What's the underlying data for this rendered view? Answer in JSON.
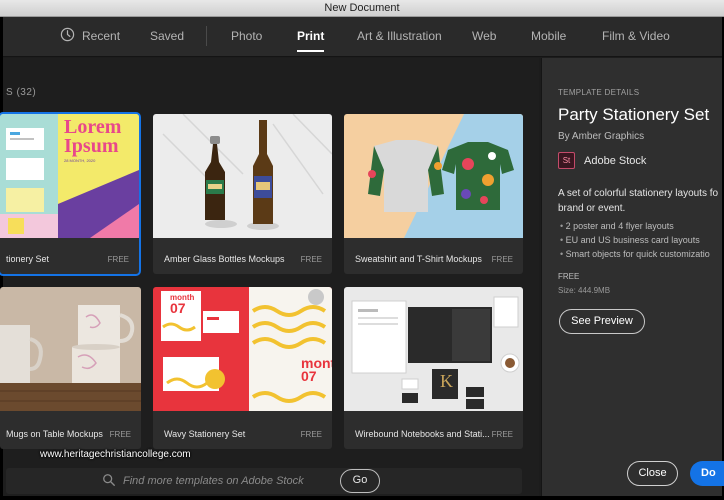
{
  "window": {
    "title": "New Document"
  },
  "tabs": [
    {
      "label": "Recent",
      "icon": "clock-icon"
    },
    {
      "label": "Saved"
    },
    {
      "label": "Photo"
    },
    {
      "label": "Print",
      "active": true
    },
    {
      "label": "Art & Illustration"
    },
    {
      "label": "Web"
    },
    {
      "label": "Mobile"
    },
    {
      "label": "Film & Video"
    }
  ],
  "section": {
    "title": "S  (32)"
  },
  "templates": [
    {
      "name": "tionery Set",
      "price": "FREE",
      "selected": true
    },
    {
      "name": "Amber Glass Bottles Mockups",
      "price": "FREE"
    },
    {
      "name": "Sweatshirt and T-Shirt Mockups",
      "price": "FREE"
    },
    {
      "name": "Mugs on Table Mockups",
      "price": "FREE"
    },
    {
      "name": "Wavy Stationery Set",
      "price": "FREE"
    },
    {
      "name": "Wirebound Notebooks and Stati...",
      "price": "FREE"
    }
  ],
  "thumb_text": {
    "lorem": "Lorem",
    "ipsum": "Ipsum",
    "date_line": "28 MONTH, 2020",
    "wavy_month": "month",
    "wavy_day": "07",
    "wavy_month_big": "montl",
    "wavy_day_big": "07"
  },
  "search": {
    "placeholder": "Find more templates on Adobe Stock",
    "go_label": "Go"
  },
  "watermark": "www.heritagechristiancollege.com",
  "details": {
    "kicker": "TEMPLATE DETAILS",
    "title": "Party Stationery Set",
    "byline": "By Amber Graphics",
    "stock_icon": "St",
    "stock_label": "Adobe Stock",
    "description": "A set of colorful stationery layouts fo brand or event.",
    "bullets": [
      "2 poster and 4 flyer layouts",
      "EU and US business card layouts",
      "Smart objects for quick customizatio"
    ],
    "license": "FREE",
    "size": "Size: 444.9MB",
    "preview_label": "See Preview"
  },
  "footer": {
    "close_label": "Close",
    "primary_label": "Do"
  },
  "colors": {
    "accent": "#1473e6",
    "panel": "#2f2f2f",
    "background": "#1e1e1e"
  }
}
